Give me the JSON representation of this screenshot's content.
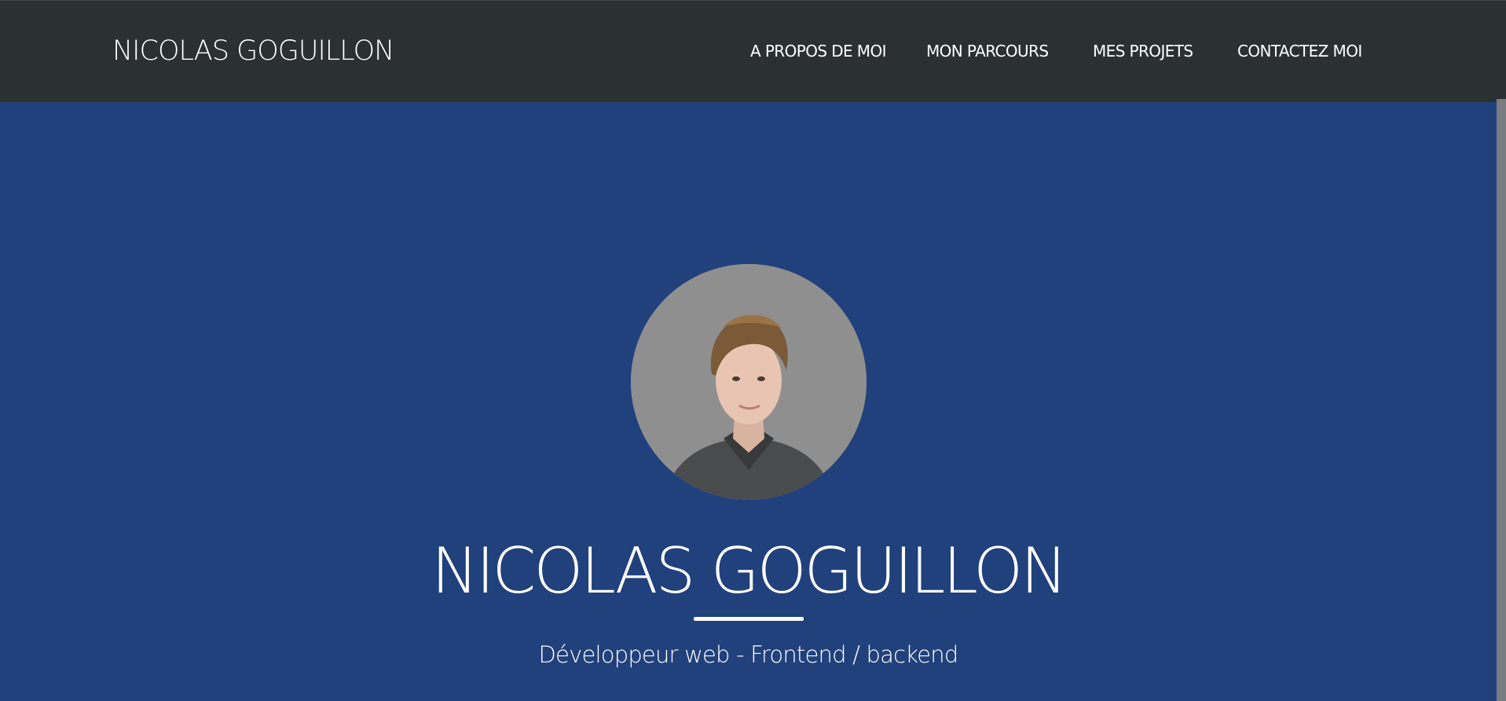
{
  "navbar": {
    "brand": "NICOLAS GOGUILLON",
    "links": [
      {
        "label": "A PROPOS DE MOI"
      },
      {
        "label": "MON PARCOURS"
      },
      {
        "label": "MES PROJETS"
      },
      {
        "label": "CONTACTEZ MOI"
      }
    ]
  },
  "hero": {
    "avatar_icon": "profile-photo",
    "name": "NICOLAS GOGUILLON",
    "subtitle": "Développeur web - Frontend / backend"
  },
  "colors": {
    "navbar_bg": "#2b3033",
    "hero_bg": "#21417c",
    "text": "#ffffff"
  }
}
